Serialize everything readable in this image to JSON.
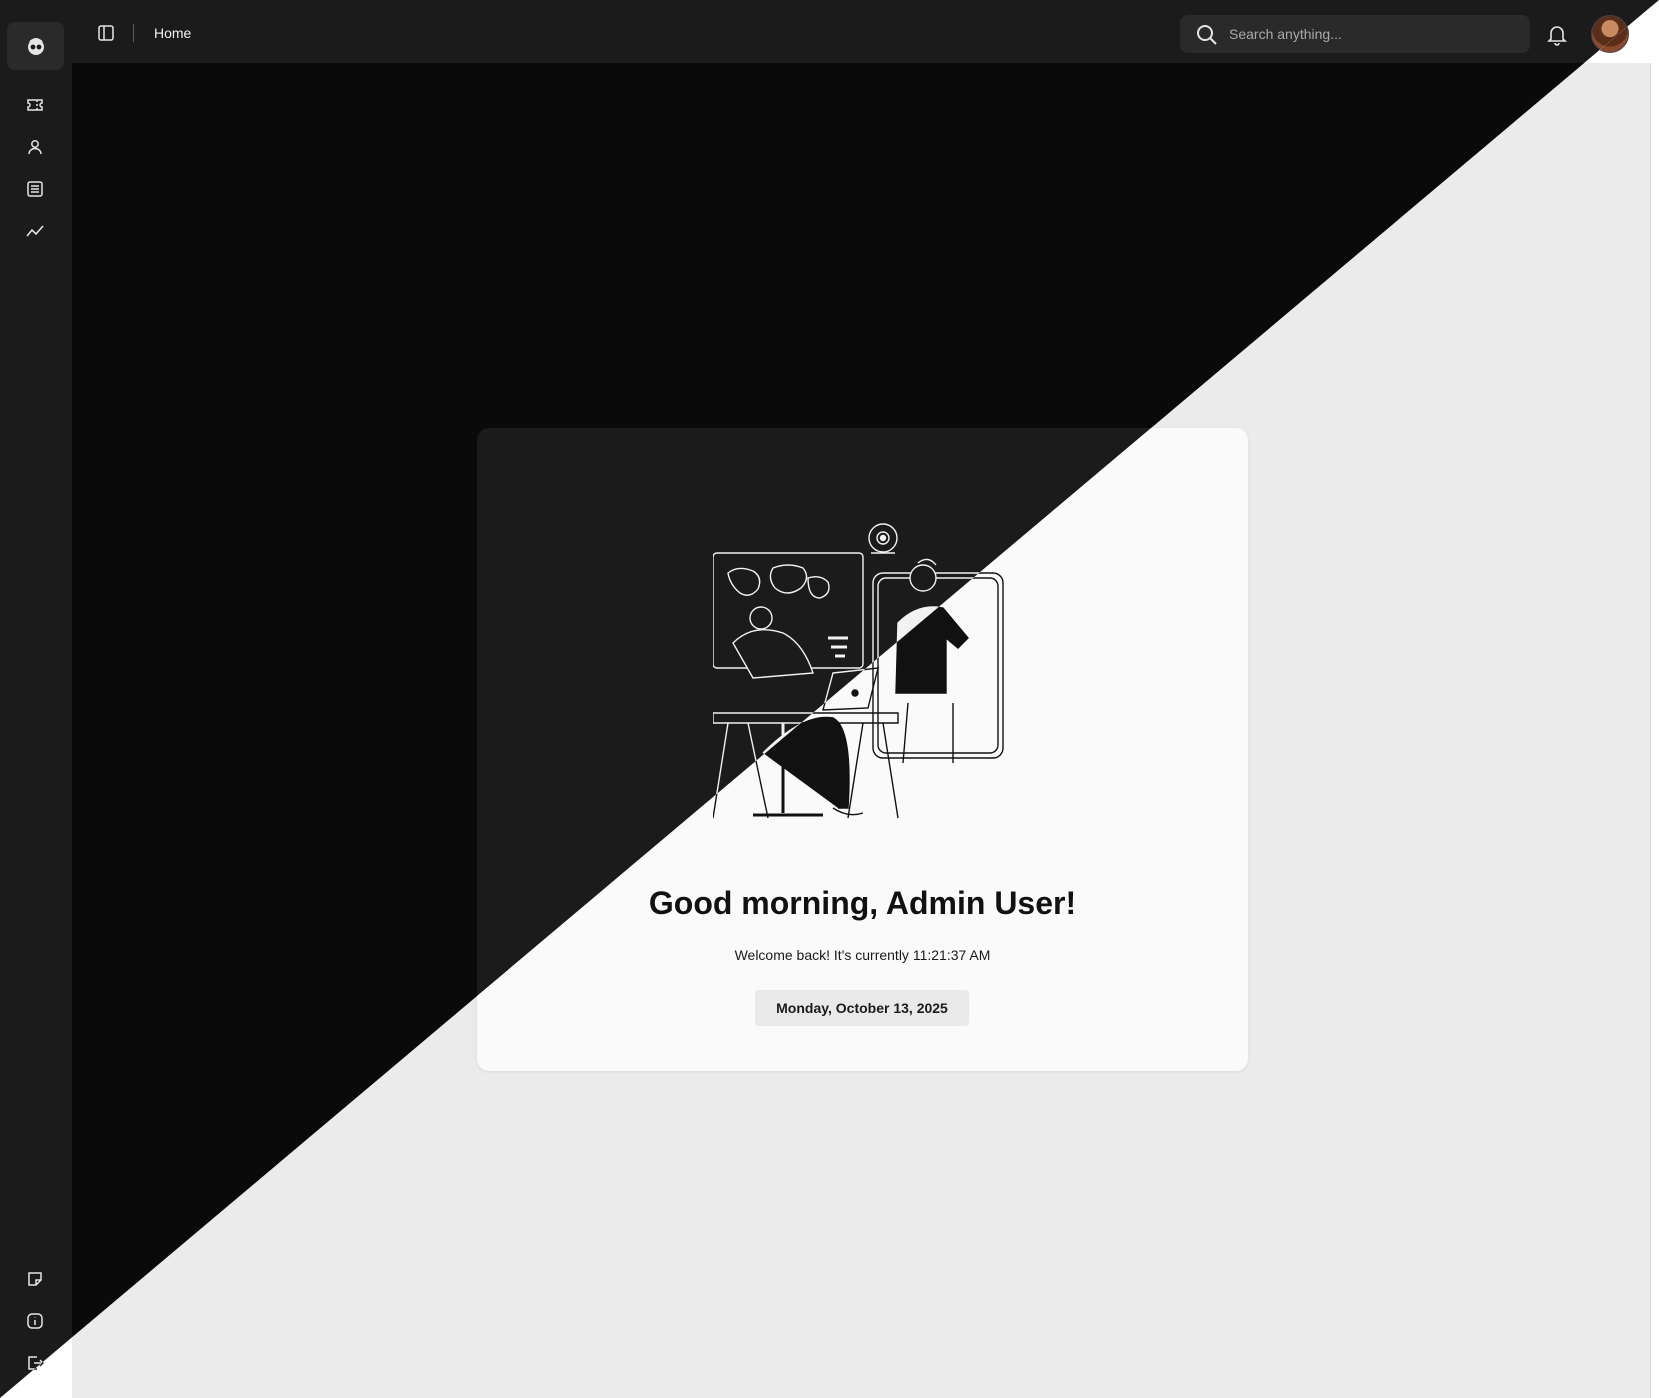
{
  "breadcrumb": {
    "current": "Home"
  },
  "search": {
    "placeholder": "Search anything..."
  },
  "sidebar": {
    "top_items": [
      {
        "icon": "ticket-icon"
      },
      {
        "icon": "user-icon"
      },
      {
        "icon": "list-icon"
      },
      {
        "icon": "activity-icon"
      }
    ],
    "bottom_items": [
      {
        "icon": "note-icon"
      },
      {
        "icon": "info-icon"
      },
      {
        "icon": "logout-icon"
      }
    ]
  },
  "welcome_card": {
    "greeting": "Good morning, Admin User!",
    "subtitle": "Welcome back! It's currently 11:21:37 AM",
    "date": "Monday, October 13, 2025"
  },
  "theme": {
    "dark_bg": "#0a0a0a",
    "dark_panel": "#1b1b1b",
    "light_bg": "#ebebeb",
    "light_panel": "#fafafa"
  }
}
